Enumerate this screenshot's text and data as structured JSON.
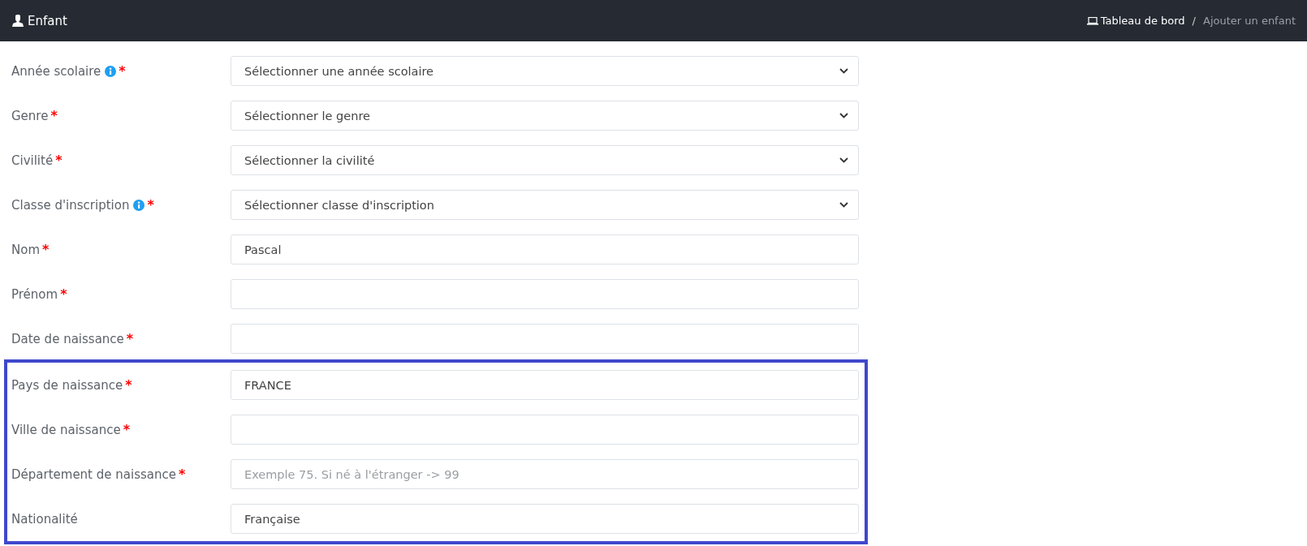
{
  "header": {
    "title": "Enfant",
    "breadcrumb": [
      {
        "label": "Tableau de bord",
        "link": true
      },
      {
        "label": "Ajouter un enfant",
        "link": false
      }
    ],
    "separator": "/"
  },
  "groups": [
    {
      "highlighted": false,
      "fields": [
        {
          "label": "Année scolaire",
          "info": true,
          "required": "*",
          "kind": "select",
          "value": "Sélectionner une année scolaire"
        },
        {
          "label": "Genre",
          "info": false,
          "required": "*",
          "kind": "select",
          "value": "Sélectionner le genre"
        },
        {
          "label": "Civilité",
          "info": false,
          "required": "*",
          "kind": "select",
          "value": "Sélectionner la civilité"
        },
        {
          "label": "Classe d'inscription",
          "info": true,
          "required": "*",
          "kind": "select",
          "value": "Sélectionner classe d'inscription"
        },
        {
          "label": "Nom",
          "info": false,
          "required": "*",
          "kind": "text",
          "value": "Pascal"
        },
        {
          "label": "Prénom",
          "info": false,
          "required": "*",
          "kind": "text"
        },
        {
          "label": "Date de naissance",
          "info": false,
          "required": "*",
          "kind": "text"
        }
      ]
    },
    {
      "highlighted": true,
      "fields": [
        {
          "label": "Pays de naissance",
          "info": false,
          "required": "*",
          "kind": "text",
          "value": "FRANCE"
        },
        {
          "label": "Ville de naissance",
          "info": false,
          "required": "*",
          "kind": "text"
        },
        {
          "label": "Département de naissance",
          "info": false,
          "required": "*",
          "kind": "text",
          "placeholder": "Exemple 75. Si né à l'étranger -> 99"
        },
        {
          "label": "Nationalité",
          "info": false,
          "kind": "text",
          "value": "Française"
        }
      ]
    }
  ]
}
